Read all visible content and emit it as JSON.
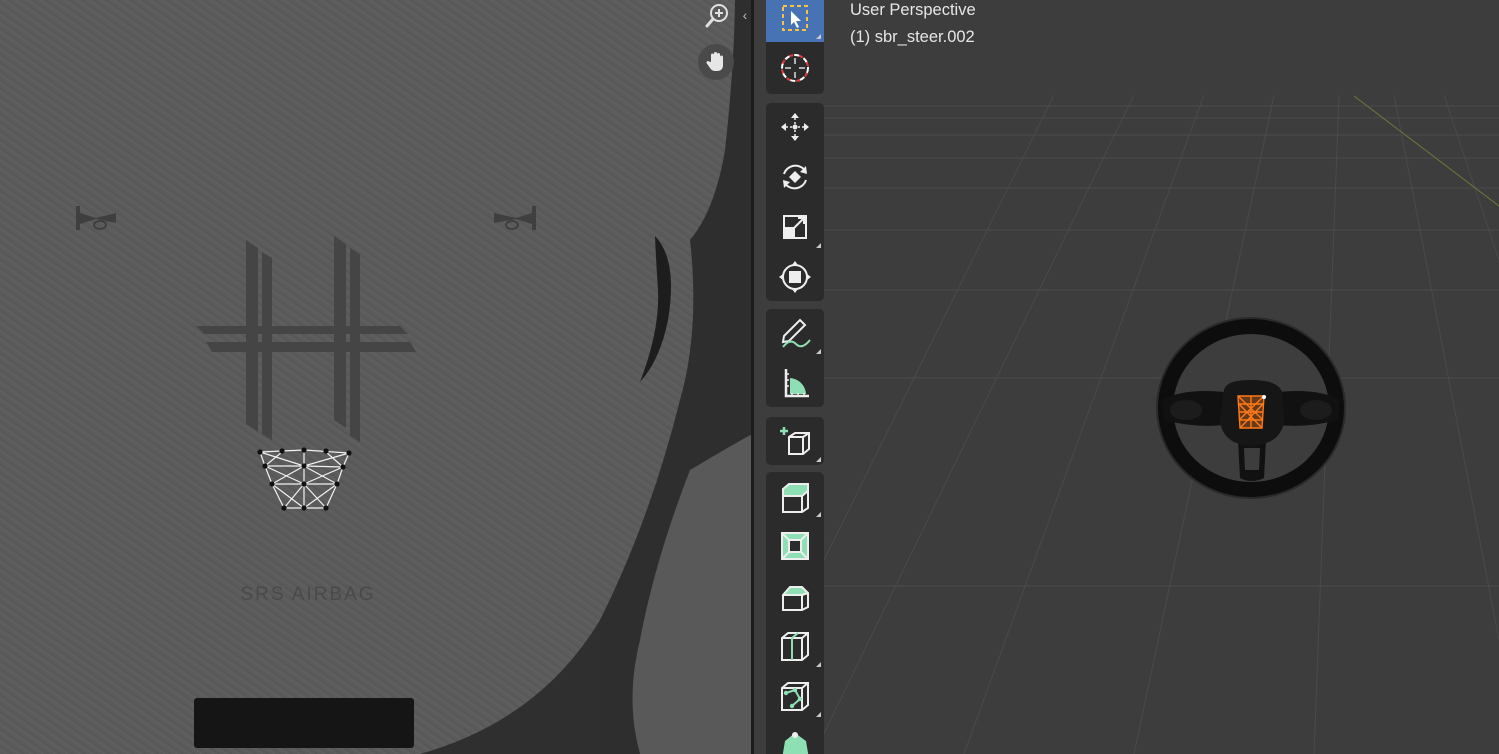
{
  "uv_editor": {
    "image_text": "SRS AIRBAG",
    "collapse_glyph": "‹",
    "icons": {
      "zoom": "zoom-in-icon",
      "pan": "hand-pan-icon"
    }
  },
  "viewport": {
    "view_name": "User Perspective",
    "object_label": "(1) sbr_steer.002",
    "colors": {
      "selection": "#ff7a1a",
      "active_tool": "#4772b3",
      "tool_accent": "#8ee0b4"
    }
  },
  "toolbar": {
    "tools": [
      {
        "name": "select-box-tool",
        "icon": "select-box-icon",
        "active": true
      },
      {
        "name": "cursor-tool",
        "icon": "cursor-target-icon"
      },
      {
        "name": "move-tool",
        "icon": "move-arrows-icon"
      },
      {
        "name": "rotate-tool",
        "icon": "rotate-icon"
      },
      {
        "name": "scale-tool",
        "icon": "scale-icon"
      },
      {
        "name": "transform-tool",
        "icon": "transform-icon"
      },
      {
        "name": "annotate-tool",
        "icon": "annotate-pencil-icon"
      },
      {
        "name": "measure-tool",
        "icon": "measure-ruler-icon"
      },
      {
        "name": "add-cube-tool",
        "icon": "add-cube-icon"
      },
      {
        "name": "extrude-tool",
        "icon": "extrude-icon"
      },
      {
        "name": "inset-faces-tool",
        "icon": "inset-faces-icon"
      },
      {
        "name": "bevel-tool",
        "icon": "bevel-icon"
      },
      {
        "name": "loop-cut-tool",
        "icon": "loop-cut-icon"
      },
      {
        "name": "knife-tool",
        "icon": "knife-icon"
      },
      {
        "name": "poly-build-tool",
        "icon": "poly-build-icon"
      }
    ]
  }
}
